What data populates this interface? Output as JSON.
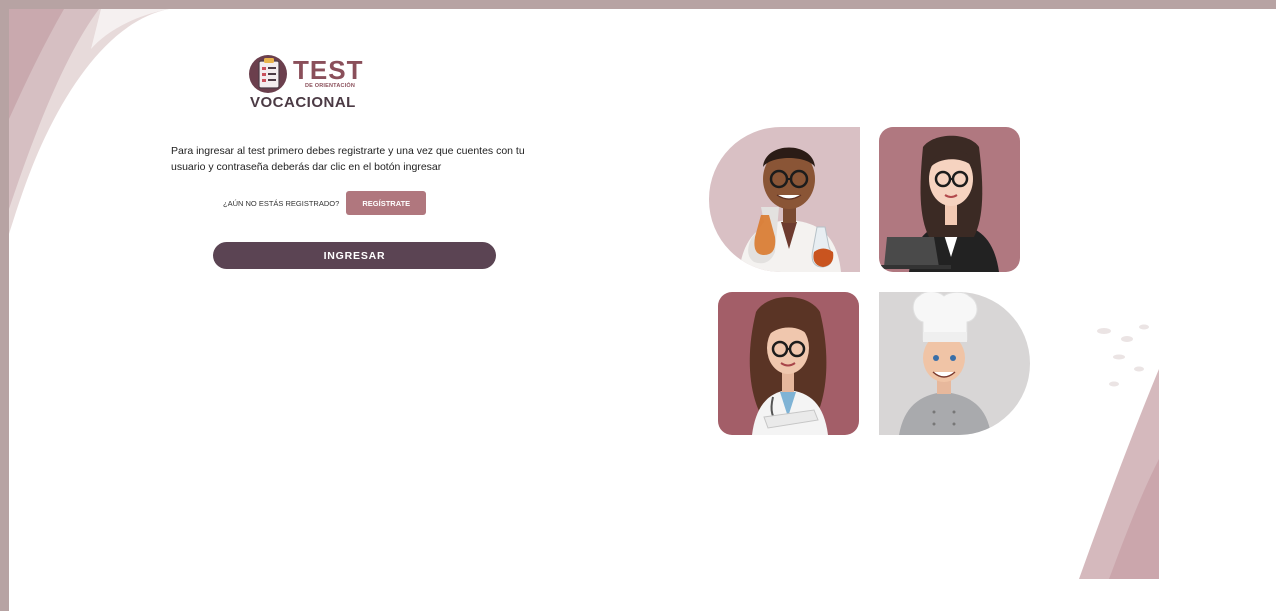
{
  "logo": {
    "title": "TEST",
    "subtitle": "DE ORIENTACIÓN",
    "word": "VOCACIONAL"
  },
  "intro_text": "Para ingresar al test primero debes registrarte y una vez que cuentes con tu usuario y contraseña deberás dar clic en el botón ingresar",
  "register": {
    "question": "¿AÚN NO ESTÁS REGISTRADO?",
    "button_label": "REGÍSTRATE"
  },
  "login_button_label": "INGRESAR",
  "colors": {
    "accent": "#b0777e",
    "primary_button": "#5b4453",
    "frame": "#b7a3a3"
  },
  "illustrations": [
    {
      "name": "scientist-illustration",
      "icon": "scientist-character"
    },
    {
      "name": "businesswoman-illustration",
      "icon": "businesswoman-character"
    },
    {
      "name": "doctor-illustration",
      "icon": "doctor-character"
    },
    {
      "name": "chef-illustration",
      "icon": "chef-character"
    }
  ]
}
